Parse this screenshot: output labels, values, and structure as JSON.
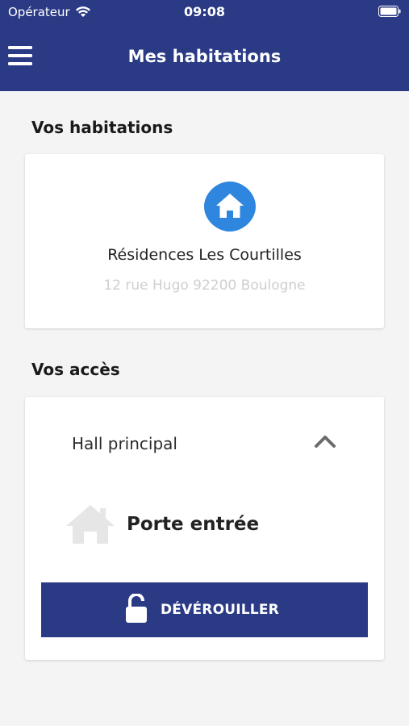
{
  "status_bar": {
    "carrier": "Opérateur",
    "time": "09:08"
  },
  "header": {
    "title": "Mes habitations",
    "menu_icon": "hamburger-menu-icon"
  },
  "habitations_section": {
    "title": "Vos habitations",
    "residence": {
      "icon": "home-icon",
      "name": "Résidences Les Courtilles",
      "address": "12 rue Hugo 92200 Boulogne"
    }
  },
  "access_section": {
    "title": "Vos accès",
    "group": {
      "label": "Hall principal",
      "expanded": true,
      "door": {
        "icon": "house-icon",
        "name": "Porte entrée"
      },
      "unlock_button": {
        "label": "DÉVÉROUILLER",
        "icon": "unlock-icon"
      }
    }
  },
  "colors": {
    "primary": "#2a3a85",
    "badge_blue": "#2e86de",
    "background": "#f4f4f4",
    "muted_text": "#cfcfcf"
  }
}
